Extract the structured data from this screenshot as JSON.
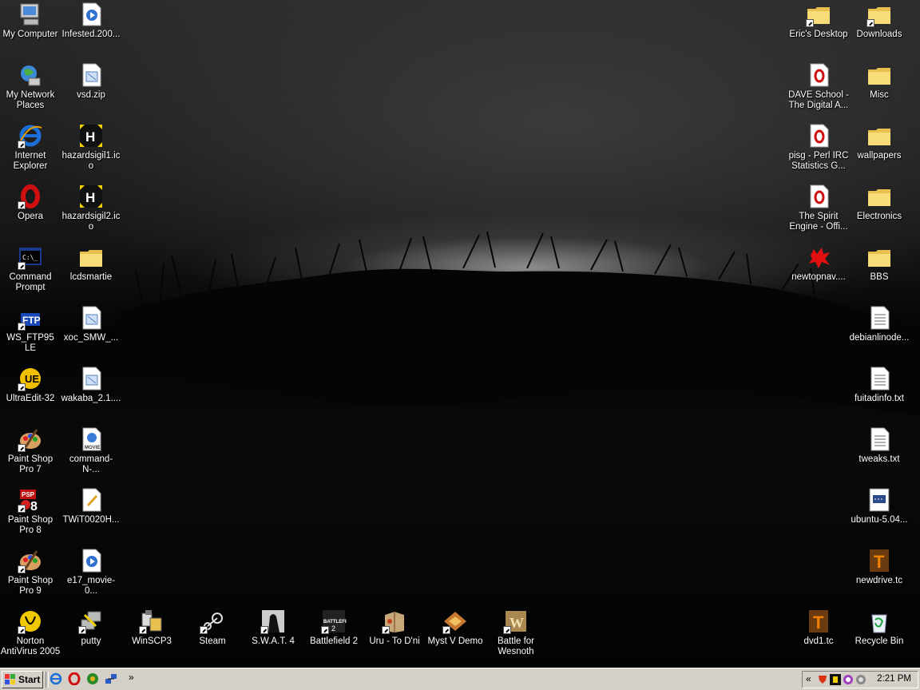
{
  "desktop": {
    "left_col1": [
      {
        "label": "My Computer",
        "icon": "my-computer-icon"
      },
      {
        "label": "My Network Places",
        "icon": "network-places-icon"
      },
      {
        "label": "Internet Explorer",
        "icon": "internet-explorer-icon"
      },
      {
        "label": "Opera",
        "icon": "opera-icon"
      },
      {
        "label": "Command Prompt",
        "icon": "command-prompt-icon"
      },
      {
        "label": "WS_FTP95 LE",
        "icon": "ws-ftp-icon"
      },
      {
        "label": "UltraEdit-32",
        "icon": "ultraedit-icon"
      },
      {
        "label": "Paint Shop Pro 7",
        "icon": "paint-shop-pro-icon"
      },
      {
        "label": "Paint Shop Pro 8",
        "icon": "psp8-icon"
      },
      {
        "label": "Paint Shop Pro 9",
        "icon": "paint-shop-pro-icon"
      },
      {
        "label": "Norton AntiVirus 2005",
        "icon": "norton-icon"
      }
    ],
    "left_col2": [
      {
        "label": "Infested.200...",
        "icon": "media-file-icon"
      },
      {
        "label": "vsd.zip",
        "icon": "zip-file-icon"
      },
      {
        "label": "hazardsigil1.ico",
        "icon": "hazard-ico-icon"
      },
      {
        "label": "hazardsigil2.ico",
        "icon": "hazard-ico-icon"
      },
      {
        "label": "lcdsmartie",
        "icon": "folder-icon"
      },
      {
        "label": "xoc_SMW_...",
        "icon": "zip-file-icon"
      },
      {
        "label": "wakaba_2.1....",
        "icon": "zip-file-icon"
      },
      {
        "label": "command-N-...",
        "icon": "quicktime-file-icon"
      },
      {
        "label": "TWiT0020H...",
        "icon": "audio-file-icon"
      },
      {
        "label": "e17_movie-0...",
        "icon": "media-file-icon"
      }
    ],
    "bottom_row": [
      {
        "label": "putty",
        "icon": "putty-icon"
      },
      {
        "label": "WinSCP3",
        "icon": "winscp-icon"
      },
      {
        "label": "Steam",
        "icon": "steam-icon"
      },
      {
        "label": "S.W.A.T. 4",
        "icon": "swat4-icon"
      },
      {
        "label": "Battlefield 2",
        "icon": "battlefield2-icon"
      },
      {
        "label": "Uru - To D'ni",
        "icon": "uru-icon"
      },
      {
        "label": "Myst V Demo",
        "icon": "myst-icon"
      },
      {
        "label": "Battle for Wesnoth",
        "icon": "wesnoth-icon"
      }
    ],
    "right_col1": [
      {
        "label": "Eric's Desktop",
        "icon": "folder-icon"
      },
      {
        "label": "DAVE School - The Digital A...",
        "icon": "opera-document-icon"
      },
      {
        "label": "pisg - Perl IRC Statistics G...",
        "icon": "opera-document-icon"
      },
      {
        "label": "The Spirit Engine - Offi...",
        "icon": "opera-document-icon"
      },
      {
        "label": "newtopnav....",
        "icon": "splat-image-icon"
      },
      {
        "label": "dvd1.tc",
        "icon": "truecrypt-icon"
      }
    ],
    "right_col2": [
      {
        "label": "Downloads",
        "icon": "folder-icon"
      },
      {
        "label": "Misc",
        "icon": "folder-icon"
      },
      {
        "label": "wallpapers",
        "icon": "folder-icon"
      },
      {
        "label": "Electronics",
        "icon": "folder-icon"
      },
      {
        "label": "BBS",
        "icon": "folder-icon"
      },
      {
        "label": "debianlinode...",
        "icon": "text-file-icon"
      },
      {
        "label": "fuitadinfo.txt",
        "icon": "text-file-icon"
      },
      {
        "label": "tweaks.txt",
        "icon": "text-file-icon"
      },
      {
        "label": "ubuntu-5.04...",
        "icon": "disc-image-icon"
      },
      {
        "label": "newdrive.tc",
        "icon": "truecrypt-icon"
      },
      {
        "label": "Recycle Bin",
        "icon": "recycle-bin-icon"
      }
    ]
  },
  "taskbar": {
    "start_label": "Start",
    "quicklaunch": [
      "internet-explorer-icon",
      "opera-icon",
      "browser-icon",
      "network-icon"
    ],
    "chevron": "»",
    "tray_chevron": "«",
    "tray_icons": [
      "shield-icon",
      "hazard-icon",
      "chat-icon",
      "volume-icon"
    ],
    "clock": "2:21 PM"
  }
}
